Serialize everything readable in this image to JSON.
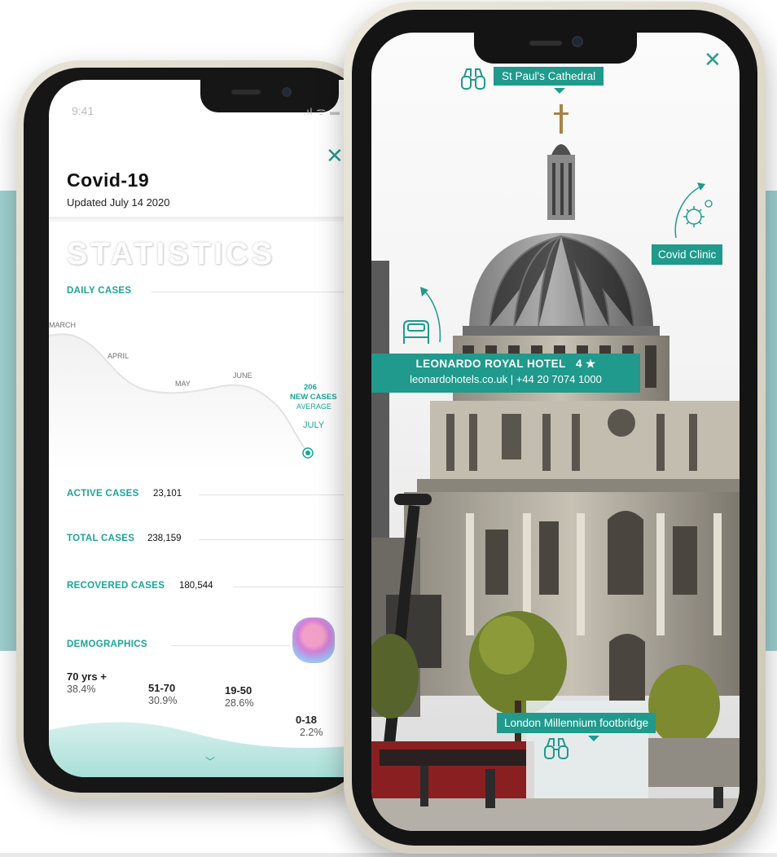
{
  "left_phone": {
    "status_bar": {
      "time": "9:41"
    },
    "header": {
      "title": "Covid-19",
      "subtitle": "Updated July 14 2020"
    },
    "watermark": "STATISTICS",
    "daily_cases": {
      "label": "DAILY CASES",
      "months": [
        "MARCH",
        "APRIL",
        "MAY",
        "JUNE",
        "JULY"
      ],
      "callout_value": "206",
      "callout_label": "NEW CASES",
      "callout_note": "AVERAGE"
    },
    "active_cases": {
      "label": "ACTIVE CASES",
      "value": "23,101"
    },
    "total_cases": {
      "label": "TOTAL CASES",
      "value": "238,159"
    },
    "recovered_cases": {
      "label": "RECOVERED CASES",
      "value": "180,544"
    },
    "demographics": {
      "label": "DEMOGRAPHICS",
      "groups": [
        {
          "age": "70 yrs +",
          "pct": "38.4%"
        },
        {
          "age": "51-70",
          "pct": "30.9%"
        },
        {
          "age": "19-50",
          "pct": "28.6%"
        },
        {
          "age": "0-18",
          "pct": "2.2%"
        }
      ]
    },
    "accent_color": "#1aa596"
  },
  "right_phone": {
    "poi": {
      "cathedral": "St Paul's Cathedral",
      "clinic": "Covid Clinic",
      "footbridge": "London Millennium footbridge"
    },
    "hotel": {
      "name": "LEONARDO ROYAL HOTEL",
      "rating": "4 ★",
      "contact": "leonardohotels.co.uk | +44 20 7074 1000"
    },
    "icons": [
      "binoculars-icon",
      "bed-icon",
      "virus-icon",
      "close-icon"
    ],
    "accent_color": "#1f9a8c"
  },
  "backdrop_color": "#9ecfcf"
}
